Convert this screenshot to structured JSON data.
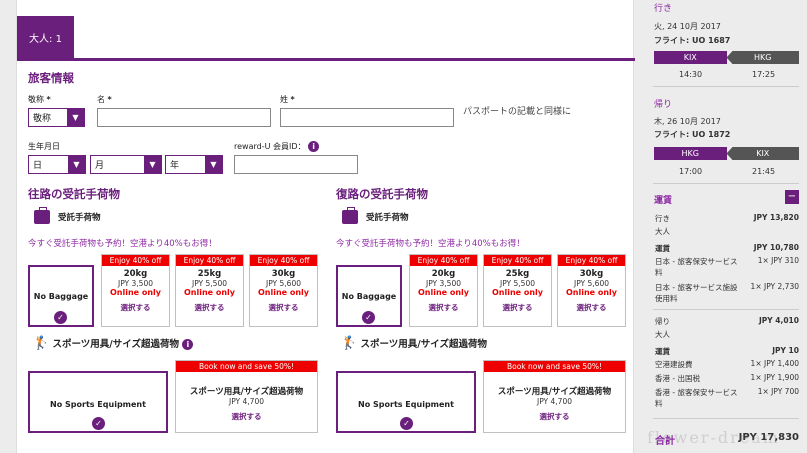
{
  "tab": {
    "label": "大人: 1"
  },
  "form": {
    "title": "旅客情報",
    "title_label": "敬称",
    "title_value": "敬称",
    "given_label": "名",
    "surname_label": "姓",
    "required_mark": "*",
    "passport_note": "パスポートの記載と同様に",
    "dob_label": "生年月日",
    "day": "日",
    "month": "月",
    "year": "年",
    "reward_label": "reward-U 会員ID："
  },
  "outbound_bag": {
    "title": "往路の受託手荷物",
    "subtitle": "受託手荷物",
    "promo": "今すぐ受託手荷物も予約！空港より40%もお得！",
    "no_baggage": "No Baggage",
    "options": [
      {
        "tag": "Enjoy 40% off",
        "weight": "20kg",
        "price": "JPY 3,500",
        "note": "Online only",
        "select": "選択する"
      },
      {
        "tag": "Enjoy 40% off",
        "weight": "25kg",
        "price": "JPY 5,500",
        "note": "Online only",
        "select": "選択する"
      },
      {
        "tag": "Enjoy 40% off",
        "weight": "30kg",
        "price": "JPY 5,600",
        "note": "Online only",
        "select": "選択する"
      }
    ],
    "sport_title": "スポーツ用具/サイズ超過荷物",
    "no_sport": "No Sports Equipment",
    "sport_option": {
      "tag": "Book now and save 50%!",
      "name": "スポーツ用具/サイズ超過荷物",
      "price": "JPY 4,700",
      "select": "選択する"
    }
  },
  "return_bag": {
    "title": "復路の受託手荷物",
    "subtitle": "受託手荷物",
    "promo": "今すぐ受託手荷物も予約！空港より40%もお得！",
    "no_baggage": "No Baggage",
    "options": [
      {
        "tag": "Enjoy 40% off",
        "weight": "20kg",
        "price": "JPY 3,500",
        "note": "Online only",
        "select": "選択する"
      },
      {
        "tag": "Enjoy 40% off",
        "weight": "25kg",
        "price": "JPY 5,500",
        "note": "Online only",
        "select": "選択する"
      },
      {
        "tag": "Enjoy 40% off",
        "weight": "30kg",
        "price": "JPY 5,600",
        "note": "Online only",
        "select": "選択する"
      }
    ],
    "sport_title": "スポーツ用具/サイズ超過荷物",
    "no_sport": "No Sports Equipment",
    "sport_option": {
      "tag": "Book now and save 50%!",
      "name": "スポーツ用具/サイズ超過荷物",
      "price": "JPY 4,700",
      "select": "選択する"
    }
  },
  "summary": {
    "outbound": {
      "heading": "行き",
      "date": "火, 24 10月 2017",
      "flight": "フライト: UO 1687",
      "from": "KIX",
      "to": "HKG",
      "dep": "14:30",
      "arr": "17:25"
    },
    "return": {
      "heading": "帰り",
      "date": "木, 26 10月 2017",
      "flight": "フライト: UO 1872",
      "from": "HKG",
      "to": "KIX",
      "dep": "17:00",
      "arr": "21:45"
    },
    "fare_heading": "運賃",
    "collapse": "−",
    "out_label": "行き",
    "out_total": "JPY 13,820",
    "out_pax": "大人",
    "out_rows": [
      {
        "k": "運賃",
        "v": "JPY 10,780"
      },
      {
        "k": "日本 - 旅客保安サービス料",
        "v": "1× JPY 310"
      },
      {
        "k": "日本 - 旅客サービス施設使用料",
        "v": "1× JPY 2,730"
      }
    ],
    "ret_label": "帰り",
    "ret_total": "JPY 4,010",
    "ret_pax": "大人",
    "ret_rows": [
      {
        "k": "運賃",
        "v": "JPY 10"
      },
      {
        "k": "空港建設費",
        "v": "1× JPY 1,400"
      },
      {
        "k": "香港 - 出国税",
        "v": "1× JPY 1,900"
      },
      {
        "k": "香港 - 旅客保安サービス料",
        "v": "1× JPY 700"
      }
    ],
    "total_label": "合計",
    "total_value": "JPY 17,830"
  },
  "watermark": "flower-dream",
  "colors": {
    "brand": "#6b1f7c",
    "promo": "#e00000"
  }
}
